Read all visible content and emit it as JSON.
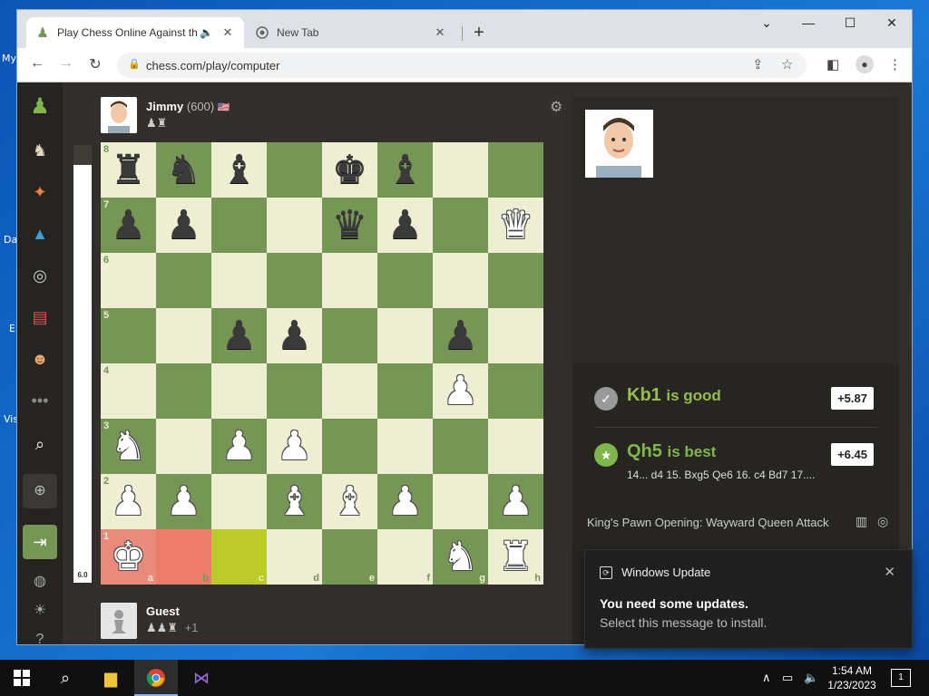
{
  "desktop": {
    "labels": [
      "My",
      "Da",
      "E",
      "Vis"
    ]
  },
  "browser": {
    "tabs": [
      {
        "title": "Play Chess Online Against th",
        "active": true
      },
      {
        "title": "New Tab",
        "active": false
      }
    ],
    "url": "chess.com/play/computer",
    "window_controls": [
      "⌄",
      "—",
      "☐",
      "✕"
    ]
  },
  "opponent": {
    "name": "Jimmy",
    "rating": "(600)",
    "flag": "🇺🇸",
    "captured": "♟♜"
  },
  "player": {
    "name": "Guest",
    "captured": "♟♟♜",
    "advantage": "+1"
  },
  "eval_bar": {
    "value": "6.0",
    "white_fraction": 0.954
  },
  "board": {
    "files": [
      "a",
      "b",
      "c",
      "d",
      "e",
      "f",
      "g",
      "h"
    ],
    "ranks": [
      "8",
      "7",
      "6",
      "5",
      "4",
      "3",
      "2",
      "1"
    ],
    "position": [
      [
        "bR",
        "bN",
        "bB",
        "",
        "bK",
        "bB",
        "",
        ""
      ],
      [
        "bP",
        "bP",
        "",
        "",
        "bQ",
        "bP",
        "",
        "wQ"
      ],
      [
        "",
        "",
        "",
        "",
        "",
        "",
        "",
        ""
      ],
      [
        "",
        "",
        "bP",
        "bP",
        "",
        "",
        "bP",
        ""
      ],
      [
        "",
        "",
        "",
        "",
        "",
        "",
        "wP",
        ""
      ],
      [
        "wN",
        "",
        "wP",
        "wP",
        "",
        "",
        "",
        ""
      ],
      [
        "wP",
        "wP",
        "",
        "wB",
        "wB",
        "wP",
        "",
        "wP"
      ],
      [
        "wK",
        "",
        "",
        "",
        "",
        "",
        "wN",
        "wR"
      ]
    ],
    "highlights": {
      "a1": "red",
      "b1": "red",
      "c1": "yellow"
    }
  },
  "coach": {
    "played": {
      "san": "Kb1",
      "verdict": "is good",
      "score": "+5.87",
      "color": "#98bc4b"
    },
    "best": {
      "san": "Qh5",
      "verdict": "is best",
      "score": "+6.45",
      "line": "14... d4 15. Bxg5 Qe6 16. c4 Bd7 17....",
      "color": "#81b64c"
    }
  },
  "opening": "King's Pawn Opening: Wayward Queen Attack",
  "toast": {
    "app": "Windows Update",
    "title": "You need some updates.",
    "body": "Select this message to install."
  },
  "taskbar": {
    "time": "1:54 AM",
    "date": "1/23/2023",
    "notifications": "1"
  }
}
